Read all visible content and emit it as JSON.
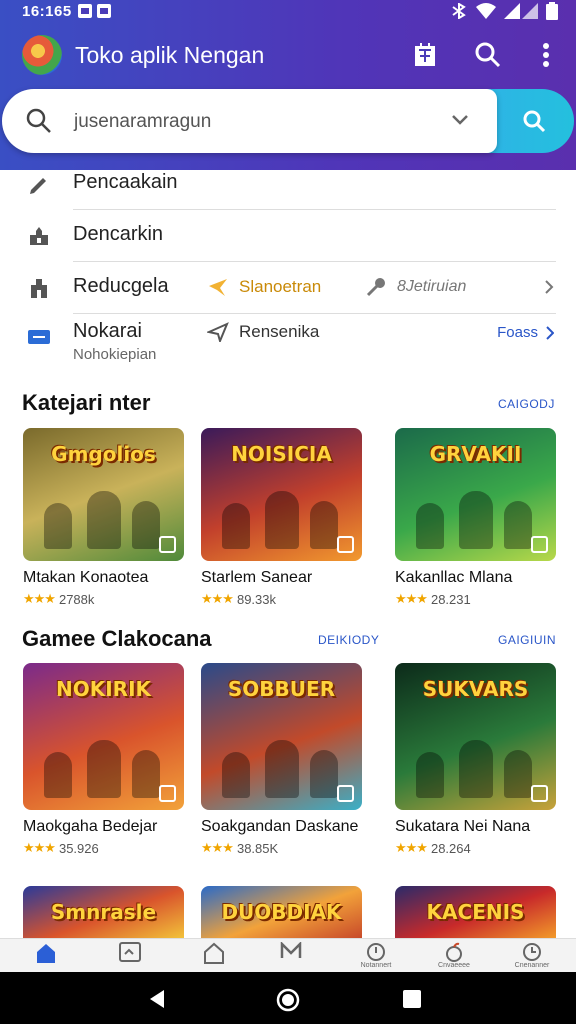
{
  "status_bar": {
    "time": "16:165"
  },
  "app_bar": {
    "title": "Toko aplik Nengan"
  },
  "search": {
    "value": "jusenaramragun"
  },
  "menu": [
    {
      "label": "Pencaakain"
    },
    {
      "label": "Dencarkin"
    },
    {
      "label": "Reducgela",
      "chip1": "Slanoetran",
      "chip2": "8Jetiruian"
    },
    {
      "label": "Nokarai",
      "sub": "Nohokiepian",
      "chip": "Rensenika",
      "action": "Foass"
    }
  ],
  "sections": [
    {
      "title": "Katejari nter",
      "link": "CAIGODJ",
      "apps": [
        {
          "name": "Mtakan Konaotea",
          "rating": "2788k",
          "thumb_title": "Gmgolios",
          "colors": [
            "#7a6a2c",
            "#c9b25a",
            "#4f8a3a"
          ]
        },
        {
          "name": "Starlem Sanear",
          "rating": "89.33k",
          "thumb_title": "NOISICIA",
          "colors": [
            "#3a1a5a",
            "#c2402c",
            "#f29a2e"
          ]
        },
        {
          "name": "Kakanllac Mlana",
          "rating": "28.231",
          "thumb_title": "GRVAKII",
          "colors": [
            "#1b6a4a",
            "#3aa84a",
            "#b8d84a"
          ]
        }
      ]
    },
    {
      "title": "Gamee Clakocana",
      "link": "DEIKIODY",
      "link2": "GAIGIUIN",
      "apps": [
        {
          "name": "Maokgaha Bedejar",
          "rating": "35.926",
          "thumb_title": "NOKIRIK",
          "colors": [
            "#7b2a8a",
            "#d9542c",
            "#f2a23a"
          ]
        },
        {
          "name": "Soakgandan Daskane",
          "rating": "38.85K",
          "thumb_title": "SOBBUER",
          "colors": [
            "#2a4a8a",
            "#c24a2a",
            "#3ab0c8"
          ]
        },
        {
          "name": "Sukatara Nei Nana",
          "rating": "28.264",
          "thumb_title": "SUKVARS",
          "colors": [
            "#0c2a1a",
            "#2a7a3a",
            "#c8a23a"
          ]
        }
      ]
    },
    {
      "apps": [
        {
          "thumb_title": "Smnrasle",
          "colors": [
            "#2a3a9a",
            "#d9542c",
            "#f2c23a"
          ]
        },
        {
          "thumb_title": "DUOBDIAK",
          "colors": [
            "#2a6ac8",
            "#f2a23a",
            "#c84a2a"
          ]
        },
        {
          "thumb_title": "KACENIS",
          "colors": [
            "#2a2a6a",
            "#c82a2a",
            "#f29a2a"
          ]
        }
      ]
    }
  ],
  "bottom_nav": [
    {
      "label": "",
      "icon": "home-icon"
    },
    {
      "label": "",
      "icon": "apps-icon"
    },
    {
      "label": "",
      "icon": "house-outline-icon"
    },
    {
      "label": "",
      "icon": "mail-icon"
    },
    {
      "label": "Notannert",
      "icon": "info-icon"
    },
    {
      "label": "Cnvaeeee",
      "icon": "apple-icon"
    },
    {
      "label": "Cnenanner",
      "icon": "clock-icon"
    }
  ]
}
